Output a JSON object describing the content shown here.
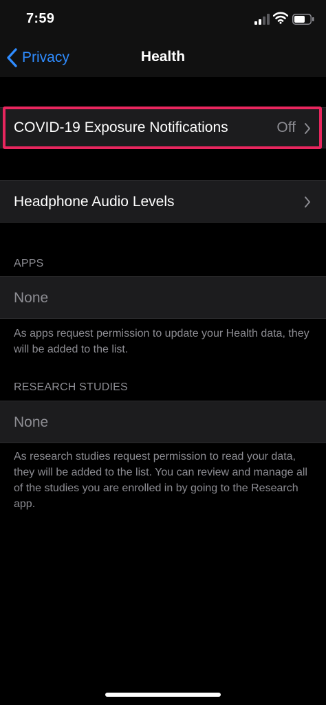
{
  "status_bar": {
    "time": "7:59",
    "icons": [
      "cellular-signal-icon",
      "wifi-icon",
      "battery-icon"
    ]
  },
  "nav": {
    "back_label": "Privacy",
    "title": "Health"
  },
  "rows": {
    "covid": {
      "label": "COVID-19 Exposure Notifications",
      "value": "Off"
    },
    "headphone": {
      "label": "Headphone Audio Levels"
    }
  },
  "apps": {
    "header": "APPS",
    "row_label": "None",
    "footer": "As apps request permission to update your Health data, they will be added to the list."
  },
  "research": {
    "header": "RESEARCH STUDIES",
    "row_label": "None",
    "footer": "As research studies request permission to read your data, they will be added to the list. You can review and manage all of the studies you are enrolled in by going to the Research app."
  },
  "colors": {
    "accent": "#2f8cff",
    "highlight": "#e8265e",
    "cell_background": "#1c1c1e",
    "secondary_text": "#8d8d93"
  }
}
